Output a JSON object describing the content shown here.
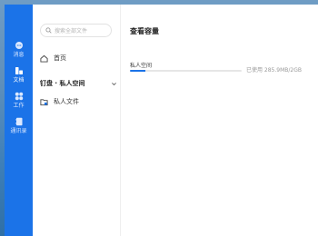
{
  "rail": {
    "items": [
      {
        "label": "消息",
        "icon": "chat-bubble-icon"
      },
      {
        "label": "文档",
        "icon": "document-icon"
      },
      {
        "label": "工作",
        "icon": "grid-apps-icon"
      },
      {
        "label": "通讯录",
        "icon": "contacts-book-icon"
      }
    ]
  },
  "sidebar": {
    "search_placeholder": "搜索全部文件",
    "home_label": "首页",
    "group_label": "钉盘 · 私人空间",
    "private_files_label": "私人文件"
  },
  "main": {
    "title": "查看容量",
    "storage_label": "私人空间",
    "usage_text": "已使用 285.9MB/2GB",
    "usage_fraction": 0.14
  },
  "colors": {
    "accent": "#1b73e8",
    "rail_bg": "#1b73e8"
  }
}
